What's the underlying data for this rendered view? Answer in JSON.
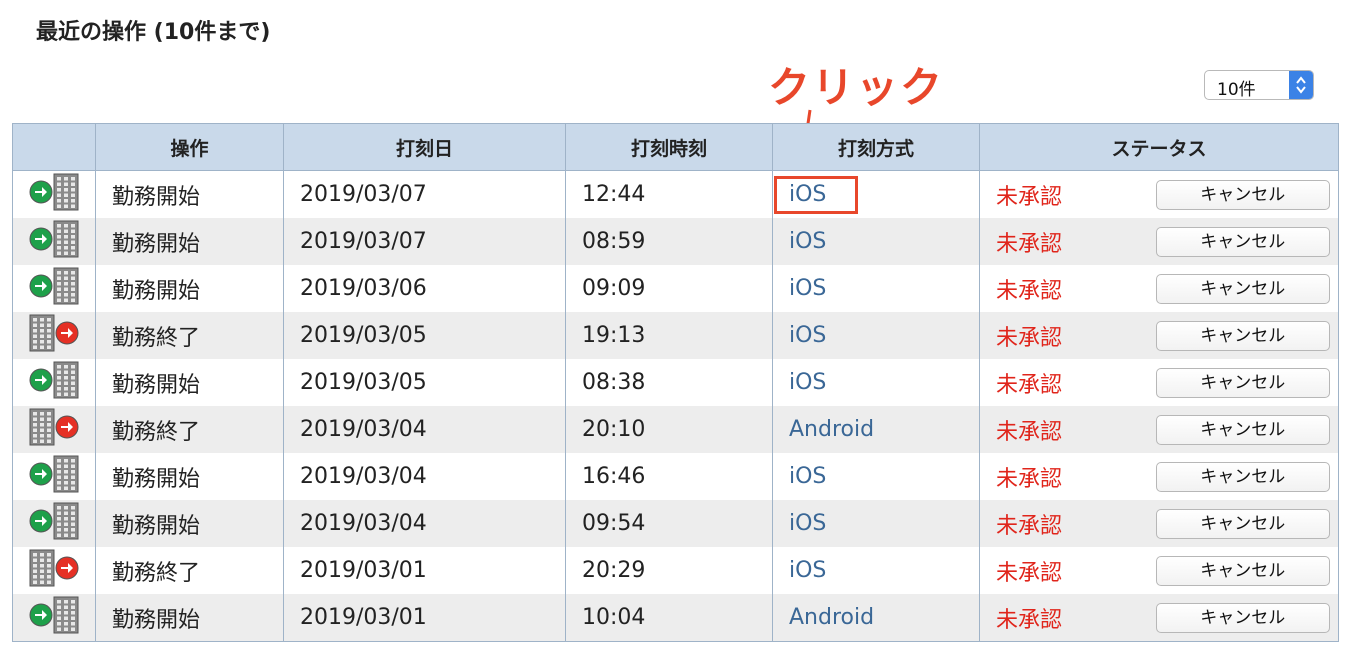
{
  "heading": "最近の操作 (10件まで)",
  "annotation": "クリック",
  "select": {
    "value": "10件"
  },
  "table": {
    "headers": [
      "",
      "操作",
      "打刻日",
      "打刻時刻",
      "打刻方式",
      "ステータス"
    ],
    "cancel_label": "キャンセル",
    "rows": [
      {
        "type": "start",
        "action": "勤務開始",
        "date": "2019/03/07",
        "time": "12:44",
        "method": "iOS",
        "status": "未承認"
      },
      {
        "type": "start",
        "action": "勤務開始",
        "date": "2019/03/07",
        "time": "08:59",
        "method": "iOS",
        "status": "未承認"
      },
      {
        "type": "start",
        "action": "勤務開始",
        "date": "2019/03/06",
        "time": "09:09",
        "method": "iOS",
        "status": "未承認"
      },
      {
        "type": "end",
        "action": "勤務終了",
        "date": "2019/03/05",
        "time": "19:13",
        "method": "iOS",
        "status": "未承認"
      },
      {
        "type": "start",
        "action": "勤務開始",
        "date": "2019/03/05",
        "time": "08:38",
        "method": "iOS",
        "status": "未承認"
      },
      {
        "type": "end",
        "action": "勤務終了",
        "date": "2019/03/04",
        "time": "20:10",
        "method": "Android",
        "status": "未承認"
      },
      {
        "type": "start",
        "action": "勤務開始",
        "date": "2019/03/04",
        "time": "16:46",
        "method": "iOS",
        "status": "未承認"
      },
      {
        "type": "start",
        "action": "勤務開始",
        "date": "2019/03/04",
        "time": "09:54",
        "method": "iOS",
        "status": "未承認"
      },
      {
        "type": "end",
        "action": "勤務終了",
        "date": "2019/03/01",
        "time": "20:29",
        "method": "iOS",
        "status": "未承認"
      },
      {
        "type": "start",
        "action": "勤務開始",
        "date": "2019/03/01",
        "time": "10:04",
        "method": "Android",
        "status": "未承認"
      }
    ]
  },
  "icons": {
    "start": [
      "green-arrow-icon",
      "building-icon"
    ],
    "end": [
      "building-icon",
      "red-arrow-icon"
    ]
  },
  "colors": {
    "annotation": "#e8472b",
    "status": "#e0251b",
    "method": "#3a6796",
    "header_bg": "#c9d9ea"
  }
}
